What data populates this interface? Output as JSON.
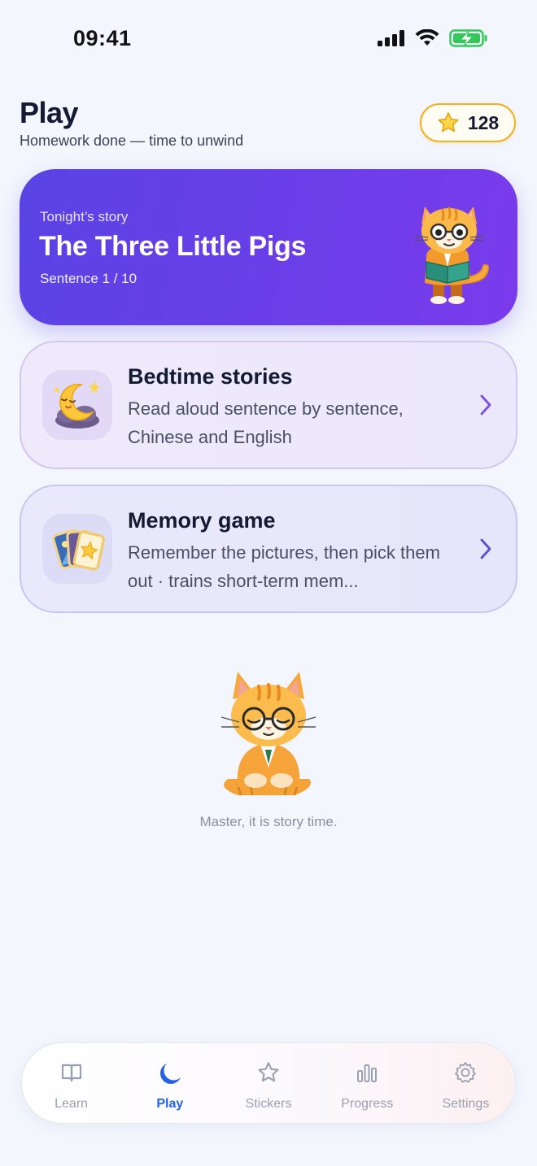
{
  "status_bar": {
    "time": "09:41"
  },
  "header": {
    "title": "Play",
    "subtitle": "Homework done — time to unwind",
    "stars": "128"
  },
  "hero": {
    "eyebrow": "Tonight’s story",
    "title": "The Three Little Pigs",
    "progress": "Sentence 1 / 10"
  },
  "cards": [
    {
      "title": "Bedtime stories",
      "description": "Read aloud sentence by sentence, Chinese and English",
      "icon": "moon-cloud-icon"
    },
    {
      "title": "Memory game",
      "description": "Remember the pictures, then pick them out · trains short-term mem...",
      "icon": "picture-cards-icon"
    }
  ],
  "mascot": {
    "caption": "Master, it is story time."
  },
  "tabs": [
    {
      "label": "Learn",
      "icon": "book-icon",
      "active": false
    },
    {
      "label": "Play",
      "icon": "moon-icon",
      "active": true
    },
    {
      "label": "Stickers",
      "icon": "star-icon",
      "active": false
    },
    {
      "label": "Progress",
      "icon": "bar-chart-icon",
      "active": false
    },
    {
      "label": "Settings",
      "icon": "gear-icon",
      "active": false
    }
  ],
  "colors": {
    "accent_blue": "#2463e6",
    "hero_gradient_start": "#5a43e4",
    "hero_gradient_end": "#7a3bec",
    "star_gold": "#f2b01e",
    "battery_green": "#34c759",
    "chevron_purple": "#7b4fe0"
  }
}
